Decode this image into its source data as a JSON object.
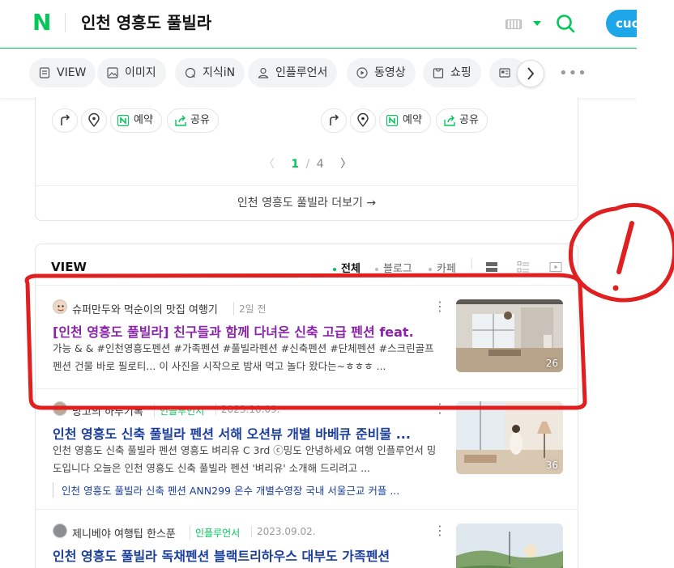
{
  "header": {
    "logo": "N",
    "query": "인천 영흥도 풀빌라",
    "profile_label": "cuc"
  },
  "tabs": [
    {
      "label": "VIEW",
      "icon": "document-icon"
    },
    {
      "label": "이미지",
      "icon": "image-icon"
    },
    {
      "label": "지식iN",
      "icon": "knowledge-icon"
    },
    {
      "label": "인플루언서",
      "icon": "person-icon"
    },
    {
      "label": "동영상",
      "icon": "play-icon"
    },
    {
      "label": "쇼핑",
      "icon": "shopping-icon"
    },
    {
      "label": "",
      "icon": "news-icon"
    }
  ],
  "place_card": {
    "actions": {
      "reserve": "예약",
      "share": "공유"
    },
    "pager": {
      "current": "1",
      "separator": "/",
      "total": "4"
    },
    "more": "인천 영흥도 풀빌라 더보기 →"
  },
  "view_section": {
    "title": "VIEW",
    "filters": [
      "전체",
      "블로그",
      "카페"
    ],
    "posts": [
      {
        "author": "슈퍼만두와 먹순이의 맛집 여행기",
        "badge": "",
        "date": "2일 전",
        "title": "[인천 영흥도 풀빌라] 친구들과 함께 다녀온 신축 고급 펜션 feat.",
        "desc": "가능 & & #인천영흥도펜션 #가족펜션 #풀빌라펜션 #신축펜션 #단체펜션 #스크린골프펜션 건물 바로 필로티... 이 사진을 시작으로 밤새 먹고 놀다 왔다는~ㅎㅎㅎ ...",
        "count": "26"
      },
      {
        "author": "망고의 하루기록",
        "badge": "인플루언서",
        "date": "2023.10.09.",
        "title": "인천 영흥도 신축 풀빌라 펜션 서해 오션뷰 개별 바베큐 준비물 ...",
        "desc": "인천 영흥도 신축 풀빌라 펜션 영흥도 벼리유 C 3rd ⓒ밍도 안녕하세요 여행 인플루언서 밍도입니다 오늘은 인천 영흥도 신축 풀빌라 펜션 '벼리유' 소개해 드리려고 ...",
        "sub": "인천 영흥도 풀빌라 신축 펜션 ANN299 온수 개별수영장 국내 서울근교 커플 ...",
        "count": "36"
      },
      {
        "author": "제니베야 여행팁 한스푼",
        "badge": "인플루언서",
        "date": "2023.09.02.",
        "title": "인천 영흥도 풀빌라 독채펜션 블랙트리하우스 대부도 가족펜션",
        "desc": "",
        "count": ""
      }
    ]
  },
  "annotation": {
    "mark": "!",
    "color": "#e02020"
  }
}
